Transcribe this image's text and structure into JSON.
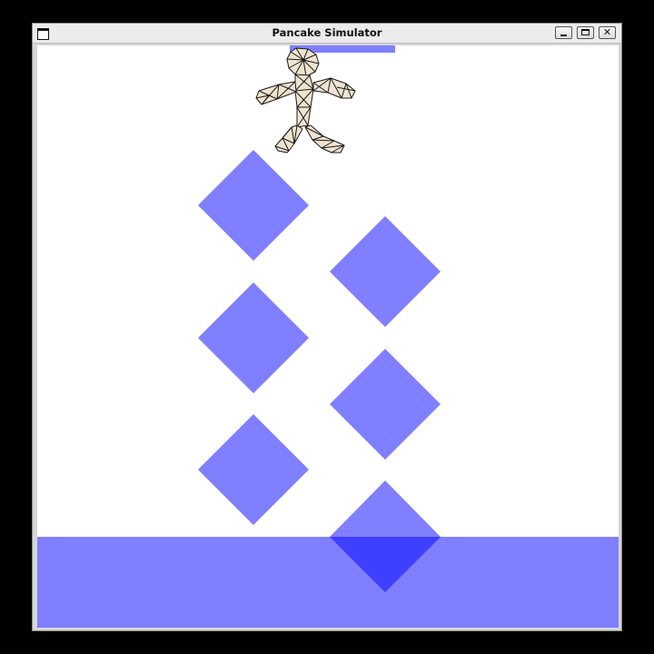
{
  "window": {
    "title": "Pancake Simulator",
    "controls": {
      "minimize_icon": "minimize-icon",
      "maximize_icon": "maximize-icon",
      "close_icon": "close-icon",
      "close_glyph": "✕"
    }
  },
  "scene": {
    "background": "#ffffff",
    "body_fill": "#7f7fff",
    "overlap_fill": "#3f3fff",
    "ragdoll_fill": "#efe4cf",
    "ragdoll_stroke": "#1a1a1a",
    "objects": [
      "spawn-bar",
      "ragdoll",
      "diamond-obstacle",
      "ground-slab"
    ]
  }
}
